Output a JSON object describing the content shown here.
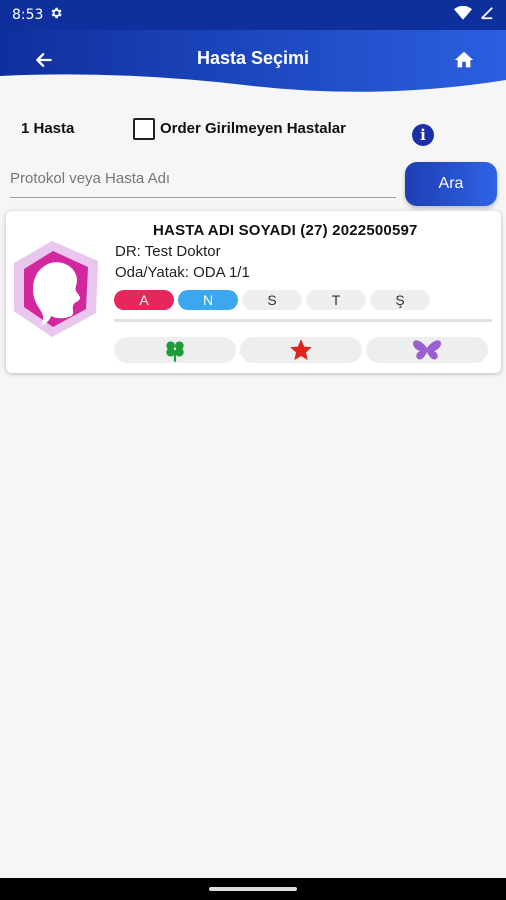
{
  "status_bar": {
    "time": "8:53",
    "icons": [
      "gear-icon",
      "wifi-icon",
      "battery-icon"
    ]
  },
  "app_bar": {
    "title": "Hasta Seçimi",
    "back_icon": "arrow-left-icon",
    "home_icon": "home-icon",
    "color_start": "#0f2f9d",
    "color_end": "#2b5fe0"
  },
  "filter": {
    "count_label": "1 Hasta",
    "checkbox_label": "Order Girilmeyen Hastalar",
    "checkbox_checked": false,
    "info_icon": "info-icon"
  },
  "search": {
    "placeholder": "Protokol veya Hasta Adı",
    "value": "",
    "button_label": "Ara"
  },
  "patients": [
    {
      "name_line": "HASTA ADI SOYADI (27) 2022500597",
      "doctor": "DR: Test Doktor",
      "room": "Oda/Yatak: ODA 1/1",
      "days": [
        {
          "label": "A",
          "bg": "#e8265e",
          "fg": "#ffffff"
        },
        {
          "label": "N",
          "bg": "#3ba7f1",
          "fg": "#ffffff"
        },
        {
          "label": "S",
          "bg": "#efefef",
          "fg": "#333333"
        },
        {
          "label": "T",
          "bg": "#efefef",
          "fg": "#333333"
        },
        {
          "label": "Ş",
          "bg": "#efefef",
          "fg": "#333333"
        }
      ],
      "tags": [
        {
          "icon": "clover-icon",
          "color": "#1e9b3a"
        },
        {
          "icon": "star-icon",
          "color": "#e0241c"
        },
        {
          "icon": "butterfly-icon",
          "color": "#9a5fd1"
        }
      ],
      "avatar_icon": "female-head-icon",
      "avatar_colors": {
        "outer": "#e8c6ee",
        "inner": "#d2279d"
      }
    }
  ]
}
